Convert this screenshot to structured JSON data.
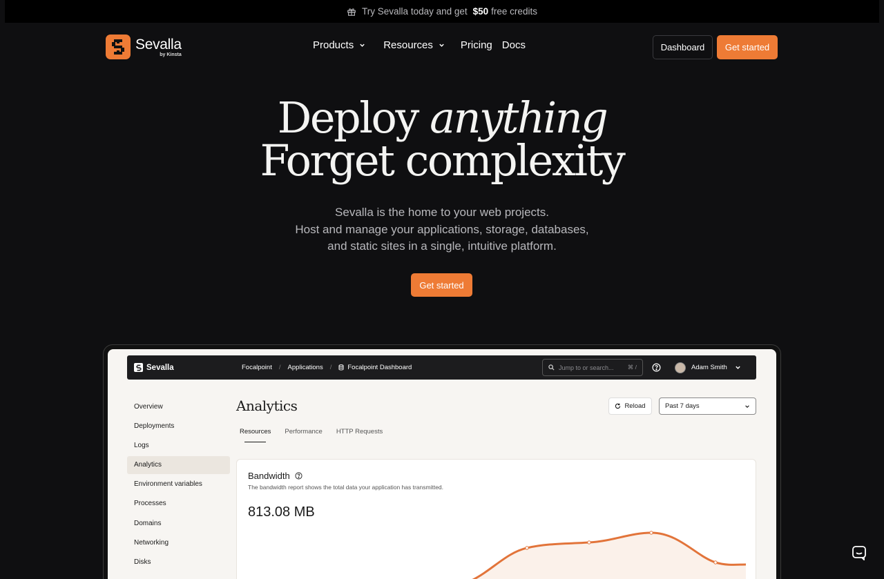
{
  "announcement": {
    "prefix": "Try Sevalla today and get",
    "amount": "$50",
    "suffix": "free credits"
  },
  "nav": {
    "logo_name": "Sevalla",
    "logo_by": "by Kinsta",
    "links": [
      "Products",
      "Resources",
      "Pricing",
      "Docs"
    ],
    "dashboard": "Dashboard",
    "get_started": "Get started"
  },
  "hero": {
    "line1_a": "Deploy",
    "line1_b": "anything",
    "line2": "Forget complexity",
    "sub1": "Sevalla is the home to your web projects.",
    "sub2": "Host and manage your applications, storage, databases,",
    "sub3": "and static sites in a single, intuitive platform.",
    "cta": "Get started"
  },
  "app": {
    "logo": "Sevalla",
    "breadcrumbs": [
      "Focalpoint",
      "Applications",
      "Focalpoint Dashboard"
    ],
    "search_placeholder": "Jump to or search...",
    "search_shortcut": "⌘ /",
    "user": "Adam Smith",
    "sidebar": [
      "Overview",
      "Deployments",
      "Logs",
      "Analytics",
      "Environment variables",
      "Processes",
      "Domains",
      "Networking",
      "Disks"
    ],
    "active_sidebar": "Analytics",
    "page_title": "Analytics",
    "reload": "Reload",
    "range": "Past 7 days",
    "tabs": [
      "Resources",
      "Performance",
      "HTTP Requests"
    ],
    "card": {
      "title": "Bandwidth",
      "desc": "The bandwidth report shows the total data your application has transmitted.",
      "value": "813.08 MB"
    }
  },
  "colors": {
    "accent": "#ee7b35",
    "background": "#0f0f11",
    "panel": "#f7f5f2"
  }
}
